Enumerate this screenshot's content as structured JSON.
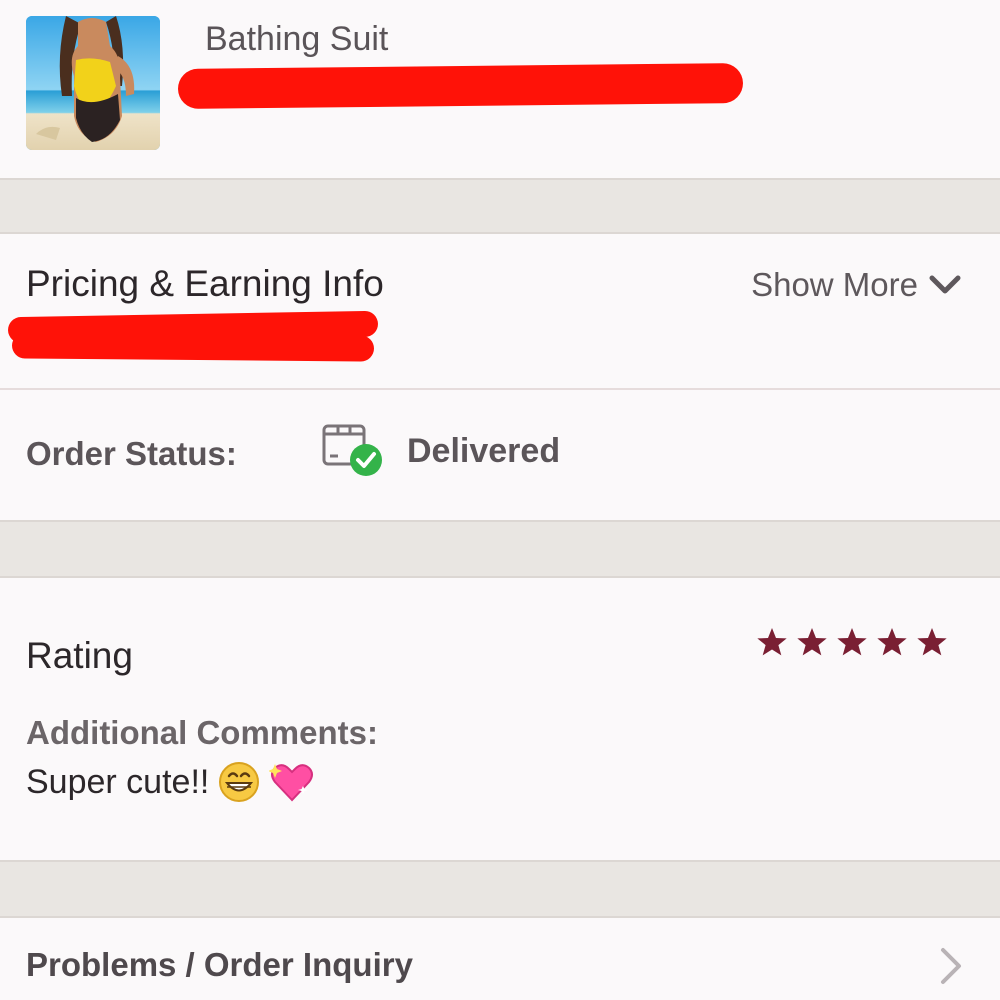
{
  "item": {
    "title": "Bathing Suit",
    "thumbnail_icon": "swimsuit-photo"
  },
  "pricing": {
    "title": "Pricing & Earning Info",
    "show_more_label": "Show More",
    "show_more_icon": "chevron-down-icon"
  },
  "order_status": {
    "label": "Order Status:",
    "value": "Delivered",
    "icon": "package-delivered-icon"
  },
  "rating": {
    "title": "Rating",
    "stars": 5,
    "star_color": "#7a1f33",
    "comments_label": "Additional Comments:",
    "comment": "Super cute!!",
    "comment_emoji": [
      "grinning-face-icon",
      "sparkling-heart-icon"
    ]
  },
  "problems": {
    "label": "Problems / Order Inquiry",
    "icon": "chevron-right-icon"
  },
  "colors": {
    "redaction": "#ff1208",
    "success": "#34b34a",
    "background": "#fbf9fa",
    "separator": "#e9e6e2"
  }
}
